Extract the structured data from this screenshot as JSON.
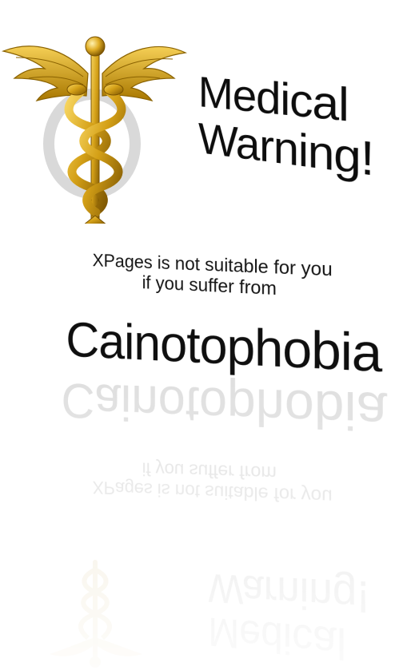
{
  "header": {
    "title_line1": "Medical",
    "title_line2": "Warning!"
  },
  "message": {
    "line1": "XPages is not suitable for you",
    "line2": "if you suffer from"
  },
  "condition": {
    "name": "Cainotophobia"
  },
  "colors": {
    "gold": "#d4a017",
    "gold_dark": "#8a6200",
    "text": "#111111",
    "background": "#ffffff"
  },
  "icons": {
    "emblem": "caduceus-icon"
  }
}
